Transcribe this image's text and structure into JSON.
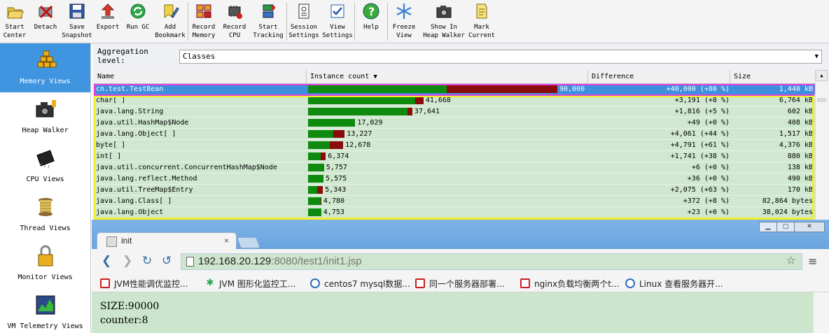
{
  "toolbar": {
    "buttons": [
      {
        "label": "Start\nCenter",
        "icon": "folder-open-icon"
      },
      {
        "label": "Detach",
        "icon": "detach-icon"
      },
      {
        "label": "Save\nSnapshot",
        "icon": "floppy-disk-icon"
      },
      {
        "label": "Export",
        "icon": "export-arrow-icon"
      },
      {
        "label": "Run GC",
        "icon": "recycle-icon"
      },
      {
        "label": "Add\nBookmark",
        "icon": "bookmark-pencil-icon"
      },
      {
        "label": "Record\nMemory",
        "icon": "record-memory-icon"
      },
      {
        "label": "Record\nCPU",
        "icon": "record-cpu-icon"
      },
      {
        "label": "Start\nTracking",
        "icon": "tracking-icon"
      },
      {
        "label": "Session\nSettings",
        "icon": "session-settings-icon"
      },
      {
        "label": "View\nSettings",
        "icon": "view-settings-icon"
      },
      {
        "label": "Help",
        "icon": "help-icon"
      },
      {
        "label": "Freeze\nView",
        "icon": "snowflake-icon"
      },
      {
        "label": "Show In\nHeap Walker",
        "icon": "camera-icon"
      },
      {
        "label": "Mark\nCurrent",
        "icon": "mark-current-icon"
      }
    ]
  },
  "sidebar": {
    "items": [
      {
        "label": "Memory Views",
        "icon": "memory-views-icon",
        "active": true
      },
      {
        "label": "Heap Walker",
        "icon": "heap-walker-icon",
        "active": false
      },
      {
        "label": "CPU Views",
        "icon": "cpu-chip-icon",
        "active": false
      },
      {
        "label": "Thread Views",
        "icon": "thread-spool-icon",
        "active": false
      },
      {
        "label": "Monitor Views",
        "icon": "padlock-icon",
        "active": false
      },
      {
        "label": "VM Telemetry Views",
        "icon": "telemetry-chart-icon",
        "active": false
      }
    ]
  },
  "aggregation": {
    "label": "Aggregation level:",
    "value": "Classes"
  },
  "table": {
    "headers": {
      "name": "Name",
      "count": "Instance count",
      "diff": "Difference",
      "size": "Size"
    },
    "sort_indicator": "▼",
    "rows": [
      {
        "name": "cn.test.TestBean",
        "count": 90000,
        "count_label": "90,000",
        "diff_pct": 80,
        "difference": "+40,000 (+80 %)",
        "size": "1,440 kB"
      },
      {
        "name": "char[ ]",
        "count": 41668,
        "count_label": "41,668",
        "diff_pct": 8,
        "difference": "+3,191 (+8 %)",
        "size": "6,764 kB"
      },
      {
        "name": "java.lang.String",
        "count": 37641,
        "count_label": "37,641",
        "diff_pct": 5,
        "difference": "+1,816 (+5 %)",
        "size": "602 kB"
      },
      {
        "name": "java.util.HashMap$Node",
        "count": 17029,
        "count_label": "17,029",
        "diff_pct": 0,
        "difference": "+49 (+0 %)",
        "size": "408 kB"
      },
      {
        "name": "java.lang.Object[ ]",
        "count": 13227,
        "count_label": "13,227",
        "diff_pct": 44,
        "difference": "+4,061 (+44 %)",
        "size": "1,517 kB"
      },
      {
        "name": "byte[ ]",
        "count": 12678,
        "count_label": "12,678",
        "diff_pct": 61,
        "difference": "+4,791 (+61 %)",
        "size": "4,376 kB"
      },
      {
        "name": "int[ ]",
        "count": 6374,
        "count_label": "6,374",
        "diff_pct": 38,
        "difference": "+1,741 (+38 %)",
        "size": "880 kB"
      },
      {
        "name": "java.util.concurrent.ConcurrentHashMap$Node",
        "count": 5757,
        "count_label": "5,757",
        "diff_pct": 0,
        "difference": "+6 (+0 %)",
        "size": "138 kB"
      },
      {
        "name": "java.lang.reflect.Method",
        "count": 5575,
        "count_label": "5,575",
        "diff_pct": 0,
        "difference": "+36 (+0 %)",
        "size": "490 kB"
      },
      {
        "name": "java.util.TreeMap$Entry",
        "count": 5343,
        "count_label": "5,343",
        "diff_pct": 63,
        "difference": "+2,075 (+63 %)",
        "size": "170 kB"
      },
      {
        "name": "java.lang.Class[ ]",
        "count": 4780,
        "count_label": "4,780",
        "diff_pct": 8,
        "difference": "+372 (+8 %)",
        "size": "82,864 bytes"
      },
      {
        "name": "java.lang.Object",
        "count": 4753,
        "count_label": "4,753",
        "diff_pct": 0,
        "difference": "+23 (+0 %)",
        "size": "38,024 bytes"
      }
    ]
  },
  "browser": {
    "tab_title": "init",
    "tab_close": "×",
    "url_host": "192.168.20.129",
    "url_rest": ":8080/test1/init1.jsp",
    "bookmarks": [
      {
        "label": "JVM性能调优监控...",
        "icon": "c"
      },
      {
        "label": "JVM 图形化监控工...",
        "icon": "j"
      },
      {
        "label": "centos7 mysql数据...",
        "icon": "g"
      },
      {
        "label": "同一个服务器部署...",
        "icon": "c"
      },
      {
        "label": "nginx负载均衡两个t...",
        "icon": "c"
      },
      {
        "label": "Linux 查看服务器开...",
        "icon": "g"
      }
    ],
    "content_lines": [
      "SIZE:90000",
      "counter:8"
    ]
  },
  "colors": {
    "bar_green": "#0e8a0e",
    "bar_red": "#8b0a0a",
    "selection": "#3e8fde",
    "row_bg": "#cfe8cf",
    "sidebar_active": "#3f95e0"
  }
}
